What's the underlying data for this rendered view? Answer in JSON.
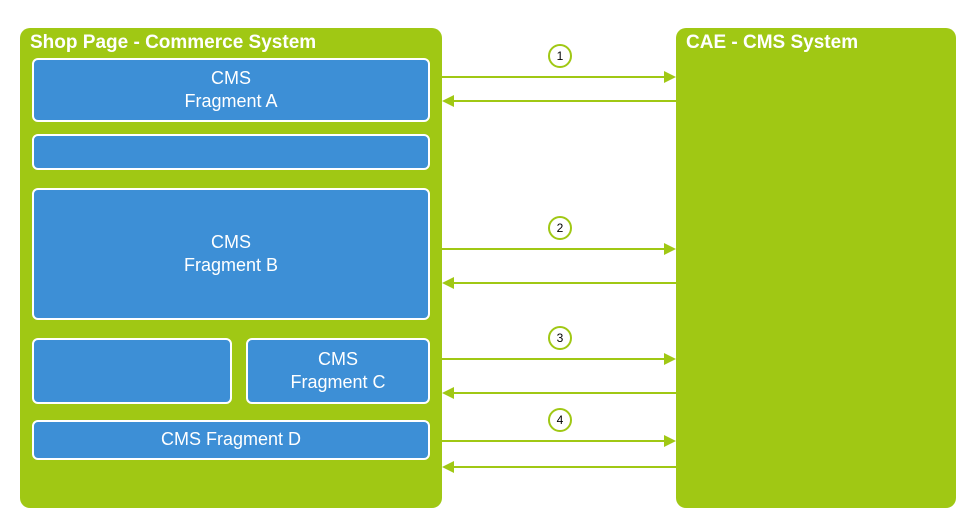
{
  "left_system": {
    "title": "Shop Page - Commerce System",
    "fragments": {
      "a": {
        "line1": "CMS",
        "line2": "Fragment A"
      },
      "spacer": "",
      "b": {
        "line1": "CMS",
        "line2": "Fragment B"
      },
      "small_left": "",
      "c": {
        "line1": "CMS",
        "line2": "Fragment C"
      },
      "d": {
        "label": "CMS Fragment D"
      }
    }
  },
  "right_system": {
    "title": "CAE - CMS System"
  },
  "arrows": {
    "a1": "1",
    "a2": "2",
    "a3": "3",
    "a4": "4"
  },
  "colors": {
    "green": "#a0c814",
    "blue": "#3d8fd6",
    "white": "#ffffff"
  }
}
